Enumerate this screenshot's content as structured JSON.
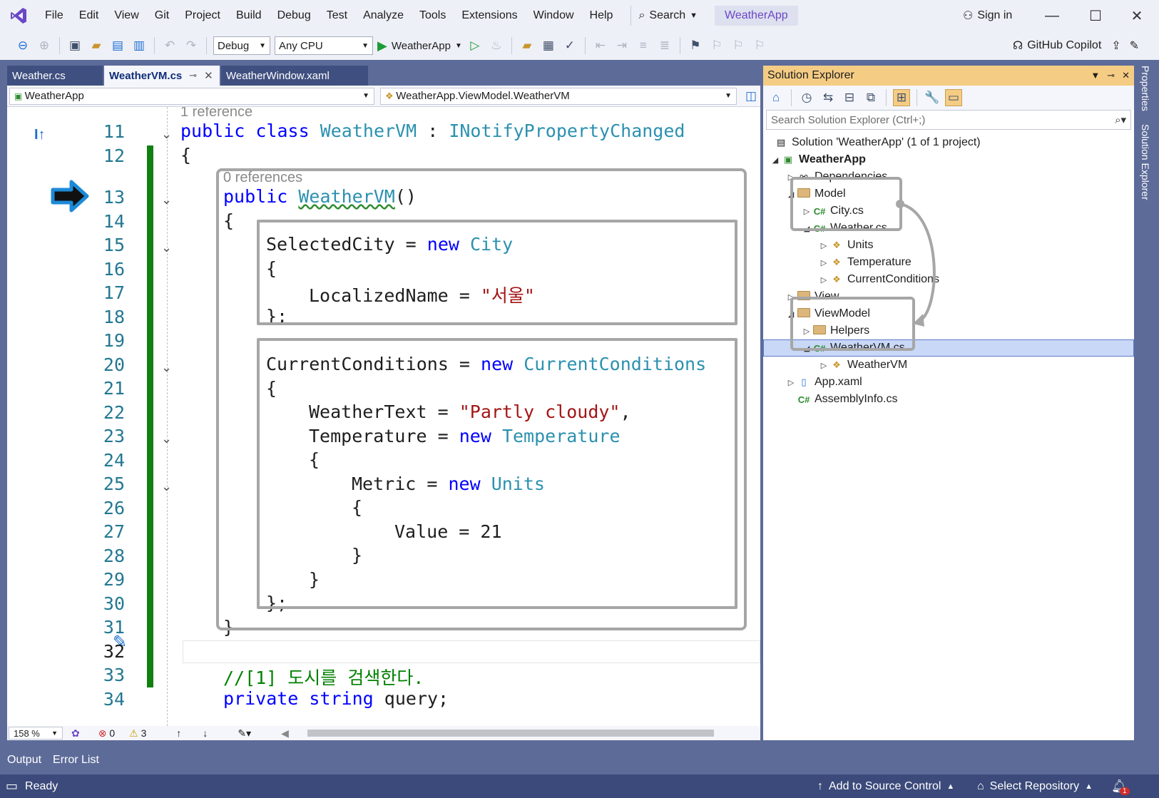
{
  "menubar": {
    "items": [
      "File",
      "Edit",
      "View",
      "Git",
      "Project",
      "Build",
      "Debug",
      "Test",
      "Analyze",
      "Tools",
      "Extensions",
      "Window",
      "Help"
    ],
    "search_label": "Search",
    "app_title": "WeatherApp",
    "sign_in": "Sign in"
  },
  "toolbar": {
    "config": "Debug",
    "platform": "Any CPU",
    "run_target": "WeatherApp",
    "copilot": "GitHub Copilot"
  },
  "tabs": [
    {
      "label": "Weather.cs"
    },
    {
      "label": "WeatherVM.cs"
    },
    {
      "label": "WeatherWindow.xaml"
    }
  ],
  "editor": {
    "project_combo": "WeatherApp",
    "member_combo": "WeatherApp.ViewModel.WeatherVM",
    "lens_class": "1 reference",
    "lens_ctor": "0 references",
    "zoom": "158 %",
    "errors": "0",
    "warnings": "3",
    "line_numbers": [
      "11",
      "12",
      "13",
      "14",
      "15",
      "16",
      "17",
      "18",
      "19",
      "20",
      "21",
      "22",
      "23",
      "24",
      "25",
      "26",
      "27",
      "28",
      "29",
      "30",
      "31",
      "32",
      "33",
      "34"
    ]
  },
  "code": {
    "l11_kw1": "public",
    "l11_kw2": "class",
    "l11_type": "WeatherVM",
    "l11_colon": " : ",
    "l11_iface": "INotifyPropertyChanged",
    "l12": "{",
    "l13_kw": "public",
    "l13_name": "WeatherVM",
    "l13_paren": "()",
    "l14": "{",
    "l15_prop": "SelectedCity = ",
    "l15_kw": "new",
    "l15_type": "City",
    "l16": "{",
    "l17_prop": "LocalizedName = ",
    "l17_str": "\"서울\"",
    "l18": "};",
    "l20_prop": "CurrentConditions = ",
    "l20_kw": "new",
    "l20_type": "CurrentConditions",
    "l21": "{",
    "l22_prop": "WeatherText = ",
    "l22_str": "\"Partly cloudy\"",
    "l22_comma": ",",
    "l23_prop": "Temperature = ",
    "l23_kw": "new",
    "l23_type": "Temperature",
    "l24": "{",
    "l25_prop": "Metric = ",
    "l25_kw": "new",
    "l25_type": "Units",
    "l26": "{",
    "l27": "Value = 21",
    "l28": "}",
    "l29": "}",
    "l30": "};",
    "l31": "}",
    "l33_comment": "//[1] 도시를 검색한다.",
    "l34_kw1": "private",
    "l34_kw2": "string",
    "l34_rest": "query;"
  },
  "solution_explorer": {
    "title": "Solution Explorer",
    "search_placeholder": "Search Solution Explorer (Ctrl+;)",
    "nodes": [
      {
        "label": "Solution 'WeatherApp' (1 of 1 project)"
      },
      {
        "label": "WeatherApp"
      },
      {
        "label": "Dependencies"
      },
      {
        "label": "Model"
      },
      {
        "label": "City.cs"
      },
      {
        "label": "Weather.cs"
      },
      {
        "label": "Units"
      },
      {
        "label": "Temperature"
      },
      {
        "label": "CurrentConditions"
      },
      {
        "label": "View"
      },
      {
        "label": "ViewModel"
      },
      {
        "label": "Helpers"
      },
      {
        "label": "WeatherVM.cs"
      },
      {
        "label": "WeatherVM"
      },
      {
        "label": "App.xaml"
      },
      {
        "label": "AssemblyInfo.cs"
      }
    ]
  },
  "side_labels": {
    "properties": "Properties",
    "solution_explorer": "Solution Explorer"
  },
  "bottom_tabs": {
    "output": "Output",
    "error_list": "Error List"
  },
  "statusbar": {
    "ready": "Ready",
    "add_source_control": "Add to Source Control",
    "select_repository": "Select Repository",
    "notification_count": "1"
  },
  "colors": {
    "accent": "#6b47c7",
    "keyword": "#0000ff",
    "type": "#2b91af",
    "string": "#a31515",
    "comment": "#008000",
    "changebar": "#108010",
    "highlight_box": "#a6a6a6",
    "arrow": "#1c8ad8"
  }
}
